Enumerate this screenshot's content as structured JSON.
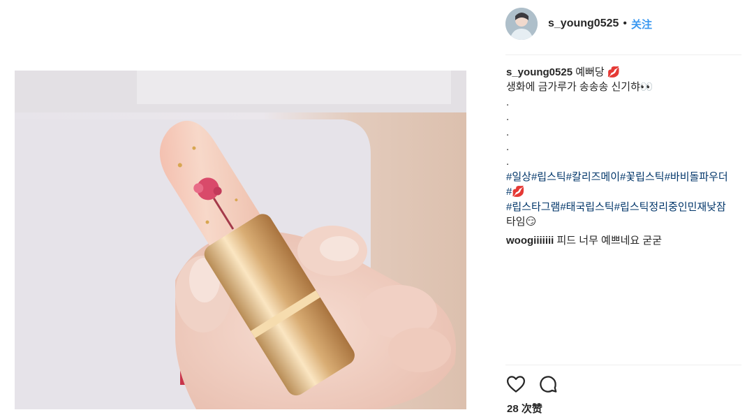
{
  "post": {
    "username": "s_young0525",
    "separator": "•",
    "follow_label": "关注"
  },
  "caption": {
    "username": "s_young0525",
    "first_line_text": "예뻐당 💋",
    "line2": "생화에 금가루가 송송송 신기햐👀",
    "dots": [
      ".",
      ".",
      ".",
      ".",
      "."
    ],
    "hashtags_line1": "#일상#립스틱#칼리즈메이#꽃립스틱#바비돌파우더",
    "hashtags_line2": "#💋",
    "hashtags_line3": "#립스타그램#태국립스틱#립스틱정리중인민재낮잠",
    "line_end": "타임😏"
  },
  "comment": {
    "username": "woogiiiiiii",
    "text": "피드 너무 예쁘네요 굳굳"
  },
  "likes": {
    "text": "28 次赞"
  },
  "icons": {
    "like": "heart-icon",
    "comment": "comment-bubble-icon"
  },
  "photo": {
    "subject": "hand holding flower jelly lipstick"
  }
}
